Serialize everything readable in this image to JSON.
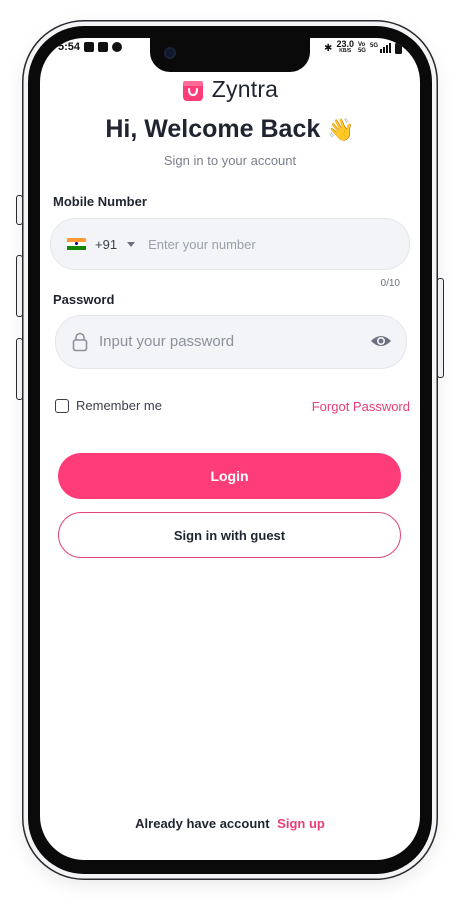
{
  "status_bar": {
    "time": "5:54",
    "network_speed": "23.0",
    "network_unit": "KB/S",
    "lte_label": "Vo\n5G",
    "signal_label": "5G"
  },
  "brand": {
    "name": "Zyntra",
    "accent_color": "#fe3d78"
  },
  "header": {
    "title": "Hi, Welcome Back",
    "emoji": "👋",
    "subtitle": "Sign in to your account"
  },
  "form": {
    "mobile_label": "Mobile Number",
    "country_code": "+91",
    "mobile_placeholder": "Enter your number",
    "char_counter": "0/10",
    "password_label": "Password",
    "password_placeholder": "Input your password",
    "remember_label": "Remember me",
    "remember_checked": false,
    "forgot_label": "Forgot Password"
  },
  "actions": {
    "login_label": "Login",
    "guest_label": "Sign in with guest"
  },
  "footer": {
    "prompt": "Already have account",
    "signup_label": "Sign up"
  }
}
